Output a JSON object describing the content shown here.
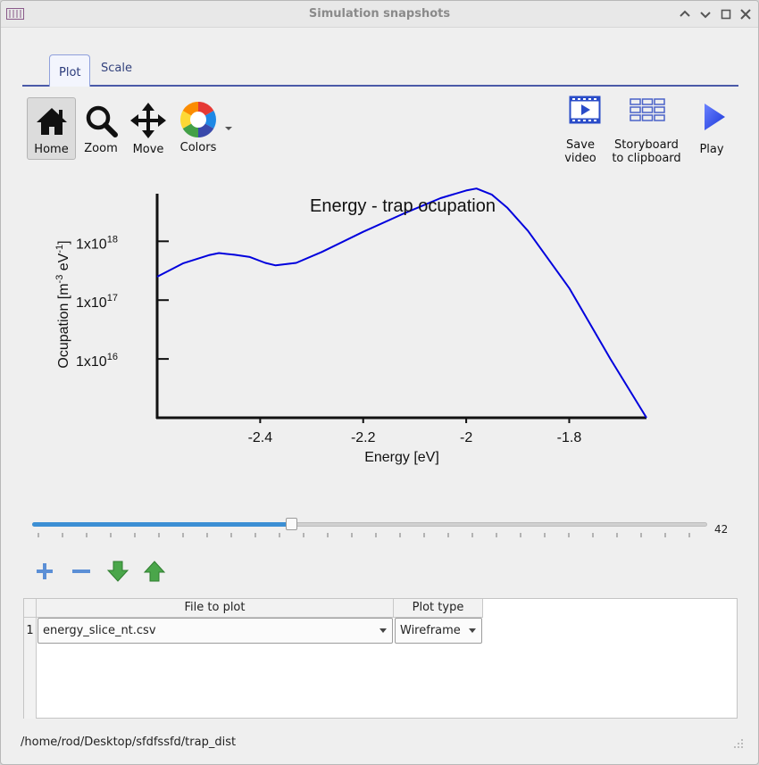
{
  "window": {
    "title": "Simulation snapshots"
  },
  "tabs": [
    {
      "label": "Plot"
    },
    {
      "label": "Scale"
    }
  ],
  "toolbar": {
    "home_label": "Home",
    "zoom_label": "Zoom",
    "move_label": "Move",
    "colors_label": "Colors",
    "save_video_label_1": "Save",
    "save_video_label_2": "video",
    "storyboard_label_1": "Storyboard",
    "storyboard_label_2": "to clipboard",
    "play_label": "Play"
  },
  "chart_data": {
    "type": "line",
    "title": "Energy - trap ocupation",
    "xlabel": "Energy [eV]",
    "ylabel_main": "Ocupation [m",
    "ylabel_sup1": "-3",
    "ylabel_mid": " eV",
    "ylabel_sup2": "-1",
    "ylabel_end": "]",
    "x_ticks": [
      "-2.4",
      "-2.2",
      "-2",
      "-1.8"
    ],
    "y_ticks": [
      {
        "base": "1x10",
        "exp": "16"
      },
      {
        "base": "1x10",
        "exp": "17"
      },
      {
        "base": "1x10",
        "exp": "18"
      }
    ],
    "x_range": [
      -2.6,
      -1.65
    ],
    "y_log_range": [
      15.0,
      18.9
    ],
    "series": [
      {
        "color": "#0000dd",
        "x": [
          -2.6,
          -2.55,
          -2.5,
          -2.48,
          -2.45,
          -2.42,
          -2.39,
          -2.37,
          -2.33,
          -2.28,
          -2.2,
          -2.12,
          -2.05,
          -2.0,
          -1.98,
          -1.95,
          -1.92,
          -1.88,
          -1.8,
          -1.72,
          -1.65
        ],
        "y": [
          2.5e+17,
          4.2e+17,
          5.8e+17,
          6.3e+17,
          5.9e+17,
          5.4e+17,
          4.3e+17,
          3.9e+17,
          4.3e+17,
          6.6e+17,
          1.45e+18,
          3e+18,
          5.4e+18,
          7.3e+18,
          7.9e+18,
          6.2e+18,
          3.7e+18,
          1.5e+18,
          1.6e+17,
          1e+16,
          1000000000000000.0
        ]
      }
    ],
    "grid": false
  },
  "slider": {
    "value": "42",
    "fraction": 0.384
  },
  "table": {
    "headers": [
      "File to plot",
      "Plot type"
    ],
    "rows": [
      {
        "num": "1",
        "file": "energy_slice_nt.csv",
        "type": "Wireframe"
      }
    ]
  },
  "status": {
    "path": "/home/rod/Desktop/sfdfssfd/trap_dist"
  }
}
